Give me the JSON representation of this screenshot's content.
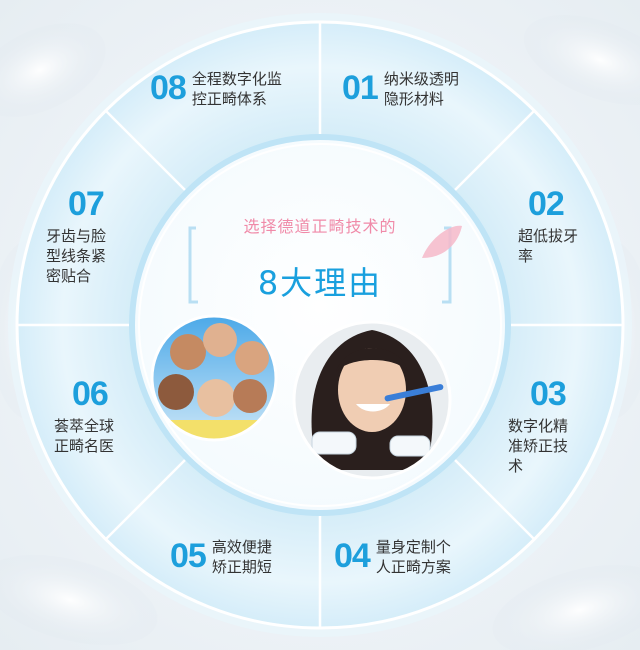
{
  "headline": {
    "top": "选择德道正畸技术的",
    "main": "8大理由"
  },
  "reasons": [
    {
      "number": "01",
      "text": "纳米级透明\n隐形材料"
    },
    {
      "number": "02",
      "text": "超低拔牙\n率"
    },
    {
      "number": "03",
      "text": "数字化精\n准矫正技\n术"
    },
    {
      "number": "04",
      "text": "量身定制个\n人正畸方案"
    },
    {
      "number": "05",
      "text": "高效便捷\n矫正期短"
    },
    {
      "number": "06",
      "text": "荟萃全球\n正畸名医"
    },
    {
      "number": "07",
      "text": "牙齿与脸\n型线条紧\n密贴合"
    },
    {
      "number": "08",
      "text": "全程数字化监\n控正畸体系"
    }
  ],
  "colors": {
    "accent_blue": "#1d9fdc",
    "ring_light": "#dff1fb",
    "headline_pink": "#f08aa8"
  },
  "icons": [
    "group-of-friends-photo",
    "woman-brushing-teeth-photo",
    "pink-petal-icon"
  ]
}
